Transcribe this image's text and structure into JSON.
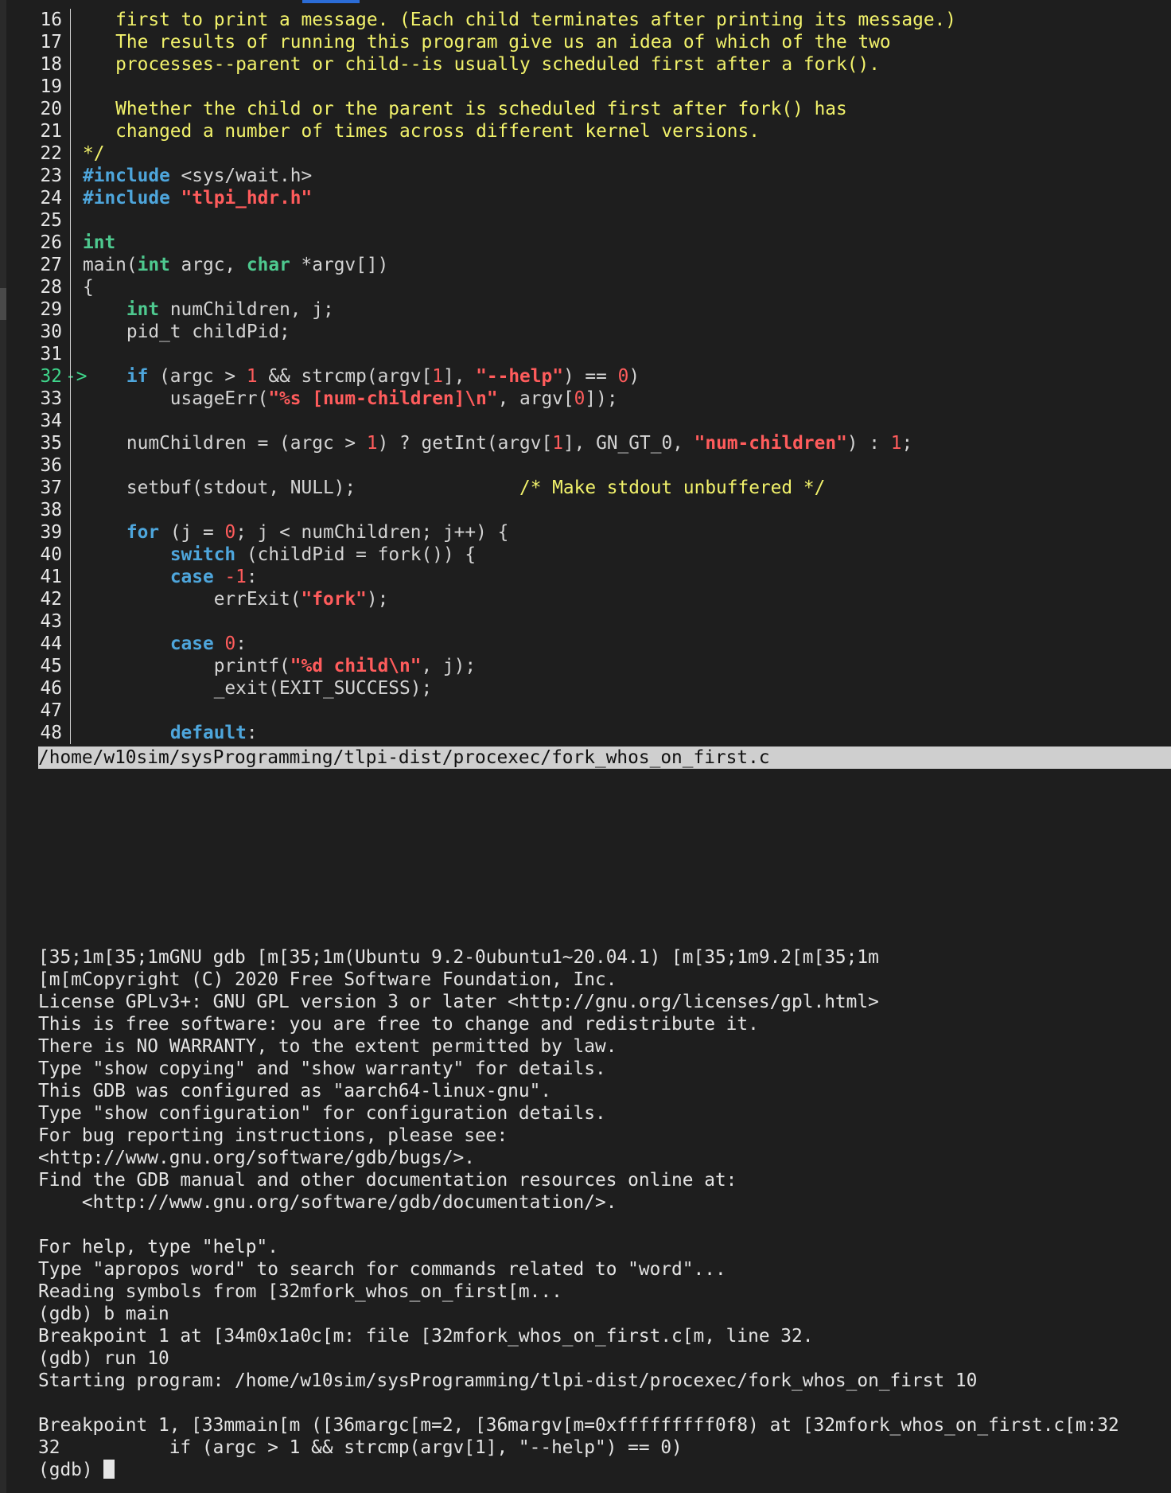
{
  "window": {
    "file_path": "/home/w10sim/sysProgramming/tlpi-dist/procexec/fork_whos_on_first.c"
  },
  "source": {
    "current_line": "32",
    "current_marker": "->",
    "lines": [
      {
        "n": "16",
        "parts": [
          [
            "cm",
            "   first to print a message. (Each child terminates after printing its message.)"
          ]
        ]
      },
      {
        "n": "17",
        "parts": [
          [
            "cm",
            "   The results of running this program give us an idea of which of the two"
          ]
        ]
      },
      {
        "n": "18",
        "parts": [
          [
            "cm",
            "   processes--parent or child--is usually scheduled first after a fork()."
          ]
        ]
      },
      {
        "n": "19",
        "parts": []
      },
      {
        "n": "20",
        "parts": [
          [
            "cm",
            "   Whether the child or the parent is scheduled first after fork() has"
          ]
        ]
      },
      {
        "n": "21",
        "parts": [
          [
            "cm",
            "   changed a number of times across different kernel versions."
          ]
        ]
      },
      {
        "n": "22",
        "parts": [
          [
            "cm",
            "*/"
          ]
        ]
      },
      {
        "n": "23",
        "parts": [
          [
            "pre",
            "#include"
          ],
          [
            "",
            " <sys/wait.h>"
          ]
        ]
      },
      {
        "n": "24",
        "parts": [
          [
            "pre",
            "#include"
          ],
          [
            "",
            " "
          ],
          [
            "str",
            "\"tlpi_hdr.h\""
          ]
        ]
      },
      {
        "n": "25",
        "parts": []
      },
      {
        "n": "26",
        "parts": [
          [
            "ty",
            "int"
          ]
        ]
      },
      {
        "n": "27",
        "parts": [
          [
            "",
            "main("
          ],
          [
            "ty",
            "int"
          ],
          [
            "",
            " argc, "
          ],
          [
            "ty",
            "char"
          ],
          [
            "",
            " *argv[])"
          ]
        ]
      },
      {
        "n": "28",
        "parts": [
          [
            "",
            "{"
          ]
        ]
      },
      {
        "n": "29",
        "parts": [
          [
            "",
            "    "
          ],
          [
            "ty",
            "int"
          ],
          [
            "",
            " numChildren, j;"
          ]
        ]
      },
      {
        "n": "30",
        "parts": [
          [
            "",
            "    pid_t childPid;"
          ]
        ]
      },
      {
        "n": "31",
        "parts": []
      },
      {
        "n": "32",
        "parts": [
          [
            "",
            "    "
          ],
          [
            "kw",
            "if"
          ],
          [
            "",
            " (argc > "
          ],
          [
            "num",
            "1"
          ],
          [
            "",
            " && strcmp(argv["
          ],
          [
            "num",
            "1"
          ],
          [
            "",
            "], "
          ],
          [
            "str",
            "\"--help\""
          ],
          [
            "",
            ") == "
          ],
          [
            "num",
            "0"
          ],
          [
            "",
            ")"
          ]
        ]
      },
      {
        "n": "33",
        "parts": [
          [
            "",
            "        usageErr("
          ],
          [
            "str",
            "\"%s [num-children]\\n\""
          ],
          [
            "",
            ", argv["
          ],
          [
            "num",
            "0"
          ],
          [
            "",
            "]);"
          ]
        ]
      },
      {
        "n": "34",
        "parts": []
      },
      {
        "n": "35",
        "parts": [
          [
            "",
            "    numChildren = (argc > "
          ],
          [
            "num",
            "1"
          ],
          [
            "",
            ") ? getInt(argv["
          ],
          [
            "num",
            "1"
          ],
          [
            "",
            "], GN_GT_0, "
          ],
          [
            "str",
            "\"num-children\""
          ],
          [
            "",
            ") : "
          ],
          [
            "num",
            "1"
          ],
          [
            "",
            ";"
          ]
        ]
      },
      {
        "n": "36",
        "parts": []
      },
      {
        "n": "37",
        "parts": [
          [
            "",
            "    setbuf(stdout, NULL);               "
          ],
          [
            "cm",
            "/* Make stdout unbuffered */"
          ]
        ]
      },
      {
        "n": "38",
        "parts": []
      },
      {
        "n": "39",
        "parts": [
          [
            "",
            "    "
          ],
          [
            "kw",
            "for"
          ],
          [
            "",
            " (j = "
          ],
          [
            "num",
            "0"
          ],
          [
            "",
            "; j < numChildren; j++) {"
          ]
        ]
      },
      {
        "n": "40",
        "parts": [
          [
            "",
            "        "
          ],
          [
            "kw",
            "switch"
          ],
          [
            "",
            " (childPid = fork()) {"
          ]
        ]
      },
      {
        "n": "41",
        "parts": [
          [
            "",
            "        "
          ],
          [
            "kw",
            "case"
          ],
          [
            "",
            " "
          ],
          [
            "num",
            "-1"
          ],
          [
            "",
            ":"
          ]
        ]
      },
      {
        "n": "42",
        "parts": [
          [
            "",
            "            errExit("
          ],
          [
            "str",
            "\"fork\""
          ],
          [
            "",
            ");"
          ]
        ]
      },
      {
        "n": "43",
        "parts": []
      },
      {
        "n": "44",
        "parts": [
          [
            "",
            "        "
          ],
          [
            "kw",
            "case"
          ],
          [
            "",
            " "
          ],
          [
            "num",
            "0"
          ],
          [
            "",
            ":"
          ]
        ]
      },
      {
        "n": "45",
        "parts": [
          [
            "",
            "            printf("
          ],
          [
            "str",
            "\"%d child\\n\""
          ],
          [
            "",
            ", j);"
          ]
        ]
      },
      {
        "n": "46",
        "parts": [
          [
            "",
            "            _exit(EXIT_SUCCESS);"
          ]
        ]
      },
      {
        "n": "47",
        "parts": []
      },
      {
        "n": "48",
        "parts": [
          [
            "",
            "        "
          ],
          [
            "kw",
            "default"
          ],
          [
            "",
            ":"
          ]
        ]
      }
    ]
  },
  "console": {
    "lines": [
      "[35;1m[35;1mGNU gdb [m[35;1m(Ubuntu 9.2-0ubuntu1~20.04.1) [m[35;1m9.2[m[35;1m",
      "[m[mCopyright (C) 2020 Free Software Foundation, Inc.",
      "License GPLv3+: GNU GPL version 3 or later <http://gnu.org/licenses/gpl.html>",
      "This is free software: you are free to change and redistribute it.",
      "There is NO WARRANTY, to the extent permitted by law.",
      "Type \"show copying\" and \"show warranty\" for details.",
      "This GDB was configured as \"aarch64-linux-gnu\".",
      "Type \"show configuration\" for configuration details.",
      "For bug reporting instructions, please see:",
      "<http://www.gnu.org/software/gdb/bugs/>.",
      "Find the GDB manual and other documentation resources online at:",
      "    <http://www.gnu.org/software/gdb/documentation/>.",
      "",
      "For help, type \"help\".",
      "Type \"apropos word\" to search for commands related to \"word\"...",
      "Reading symbols from [32mfork_whos_on_first[m...",
      "(gdb) b main",
      "Breakpoint 1 at [34m0x1a0c[m: file [32mfork_whos_on_first.c[m, line 32.",
      "(gdb) run 10",
      "Starting program: /home/w10sim/sysProgramming/tlpi-dist/procexec/fork_whos_on_first 10",
      "",
      "Breakpoint 1, [33mmain[m ([36margc[m=2, [36margv[m=0xfffffffff0f8) at [32mfork_whos_on_first.c[m:32",
      "32          if (argc > 1 && strcmp(argv[1], \"--help\") == 0)"
    ],
    "prompt": "(gdb) "
  }
}
